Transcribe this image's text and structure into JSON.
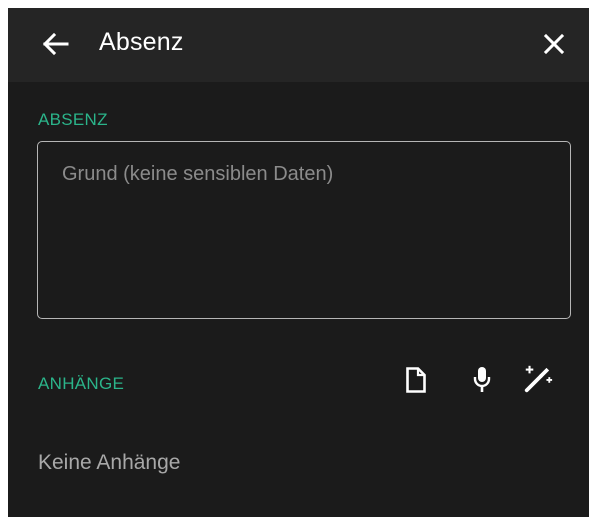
{
  "header": {
    "back_icon": "arrow-left-icon",
    "title": "Absenz",
    "close_icon": "close-icon"
  },
  "absenz_section": {
    "label": "ABSENZ",
    "reason_input": {
      "value": "",
      "placeholder": "Grund (keine sensiblen Daten)"
    }
  },
  "attachments_section": {
    "label": "ANHÄNGE",
    "actions": [
      {
        "icon": "file-icon"
      },
      {
        "icon": "microphone-icon"
      },
      {
        "icon": "magic-wand-icon"
      }
    ],
    "empty_text": "Keine Anhänge"
  },
  "colors": {
    "panel_background": "#1b1b1b",
    "header_background": "#252525",
    "accent": "#2bb48a",
    "text_primary": "#ffffff",
    "text_secondary": "#a8a8a8",
    "border": "#b6b6b6"
  }
}
